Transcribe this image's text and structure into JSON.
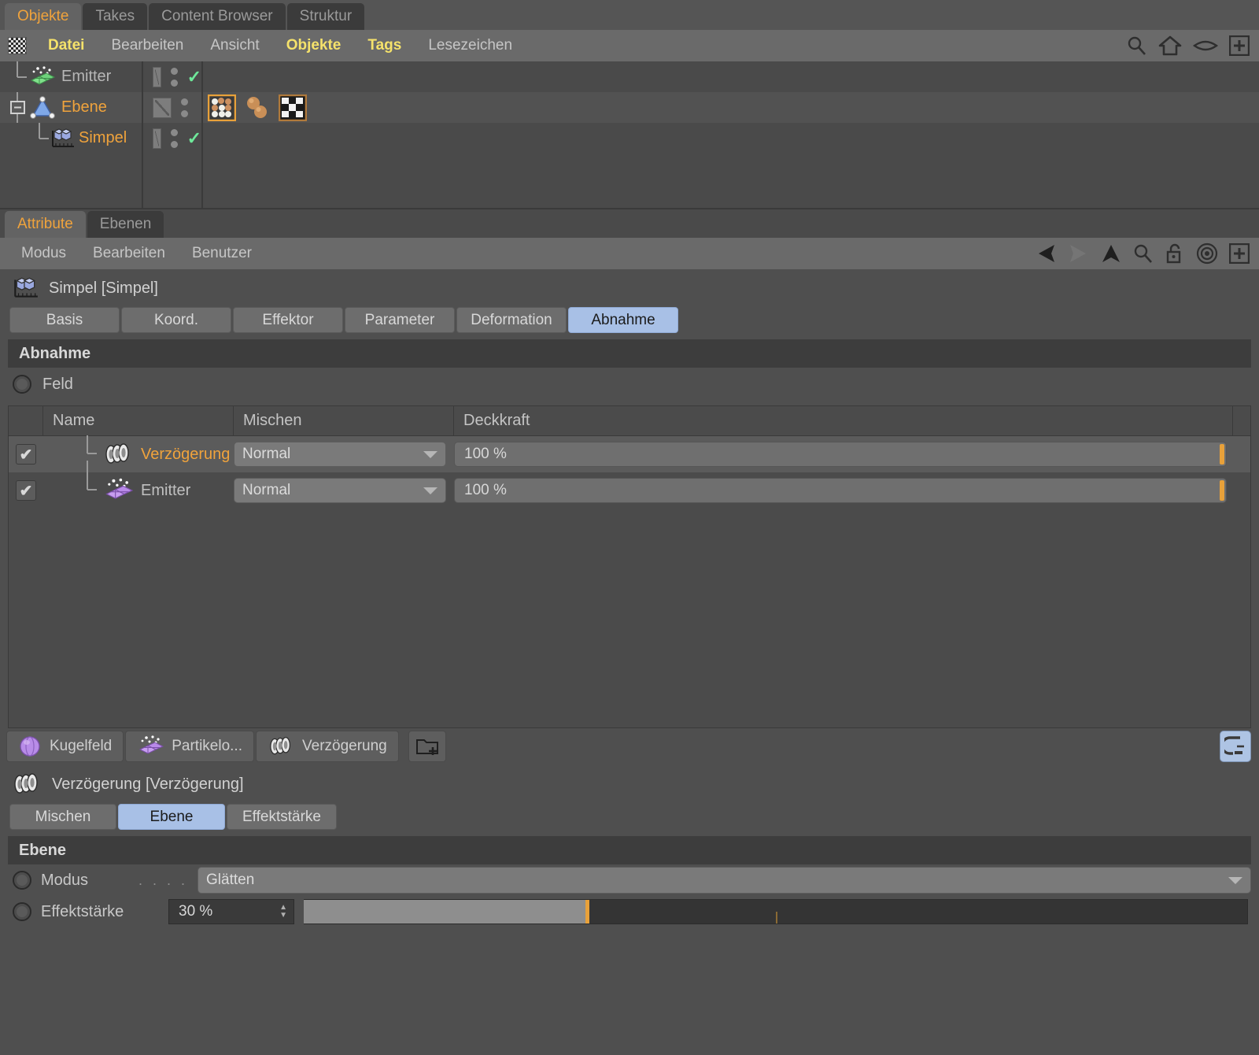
{
  "object_manager": {
    "tabs": [
      {
        "label": "Objekte",
        "active": true
      },
      {
        "label": "Takes",
        "active": false
      },
      {
        "label": "Content Browser",
        "active": false
      },
      {
        "label": "Struktur",
        "active": false
      }
    ],
    "menu": [
      {
        "label": "Datei",
        "highlight": true
      },
      {
        "label": "Bearbeiten",
        "highlight": false
      },
      {
        "label": "Ansicht",
        "highlight": false
      },
      {
        "label": "Objekte",
        "highlight": true
      },
      {
        "label": "Tags",
        "highlight": true
      },
      {
        "label": "Lesezeichen",
        "highlight": false
      }
    ],
    "toolbar_icons": [
      "search-icon",
      "home-icon",
      "eye-icon",
      "add-box-icon"
    ],
    "rows": [
      {
        "name": "Emitter",
        "icon": "particle-emitter-icon",
        "selected": false,
        "depth": 1,
        "expander": false,
        "enabled": true,
        "has_tags": false
      },
      {
        "name": "Ebene",
        "icon": "layer-triangle-icon",
        "selected": true,
        "depth": 1,
        "expander": true,
        "enabled": false,
        "has_tags": true
      },
      {
        "name": "Simpel",
        "icon": "simple-effector-icon",
        "selected": true,
        "depth": 2,
        "expander": false,
        "enabled": true,
        "has_tags": false
      }
    ],
    "tags": [
      {
        "name": "cloner-matrix-tag",
        "selected": true
      },
      {
        "name": "dynamics-spheres-tag",
        "selected": false
      },
      {
        "name": "checkerboard-material-tag",
        "selected": false
      }
    ]
  },
  "attribute_manager": {
    "tabs": [
      {
        "label": "Attribute",
        "active": true
      },
      {
        "label": "Ebenen",
        "active": false
      }
    ],
    "menu": [
      {
        "label": "Modus"
      },
      {
        "label": "Bearbeiten"
      },
      {
        "label": "Benutzer"
      }
    ],
    "toolbar_icons": [
      "back-arrow-icon",
      "forward-arrow-icon",
      "up-arrow-icon",
      "search-icon",
      "unlock-icon",
      "target-icon",
      "add-box-icon"
    ],
    "object_title": "Simpel [Simpel]",
    "object_icon": "simple-effector-icon",
    "param_tabs": [
      {
        "label": "Basis",
        "active": false
      },
      {
        "label": "Koord.",
        "active": false
      },
      {
        "label": "Effektor",
        "active": false
      },
      {
        "label": "Parameter",
        "active": false
      },
      {
        "label": "Deformation",
        "active": false
      },
      {
        "label": "Abnahme",
        "active": true
      }
    ],
    "section_title": "Abnahme",
    "field_label": "Feld",
    "list": {
      "columns": [
        "Name",
        "Mischen",
        "Deckkraft"
      ],
      "rows": [
        {
          "checked": true,
          "name": "Verzögerung",
          "icon": "delay-spiral-icon",
          "mix": "Normal",
          "opacity": "100 %",
          "selected": true
        },
        {
          "checked": true,
          "name": "Emitter",
          "icon": "particle-emitter-purple-icon",
          "mix": "Normal",
          "opacity": "100 %",
          "selected": false
        }
      ]
    },
    "presets": [
      {
        "label": "Kugelfeld",
        "icon": "sphere-field-icon"
      },
      {
        "label": "Partikelo...",
        "icon": "particle-emitter-purple-icon"
      },
      {
        "label": "Verzögerung",
        "icon": "delay-spiral-icon"
      }
    ],
    "preset_add_icon": "folder-add-icon",
    "right_icon": "clamp-icon"
  },
  "lower_panel": {
    "object_title": "Verzögerung [Verzögerung]",
    "object_icon": "delay-spiral-icon",
    "param_tabs": [
      {
        "label": "Mischen",
        "active": false
      },
      {
        "label": "Ebene",
        "active": true
      },
      {
        "label": "Effektstärke",
        "active": false
      }
    ],
    "section_title": "Ebene",
    "properties": [
      {
        "label": "Modus",
        "dots": ". . . .",
        "type": "select",
        "value": "Glätten"
      },
      {
        "label": "Effektstärke",
        "dots": "",
        "type": "slider",
        "value": "30 %",
        "percent": 30
      }
    ]
  },
  "colors": {
    "accent_orange": "#f0a33c",
    "tab_active_blue": "#a8c0e6",
    "menu_highlight_yellow": "#f5e26b",
    "check_green": "#6ee89a",
    "slider_mark": "#e8a13a"
  }
}
